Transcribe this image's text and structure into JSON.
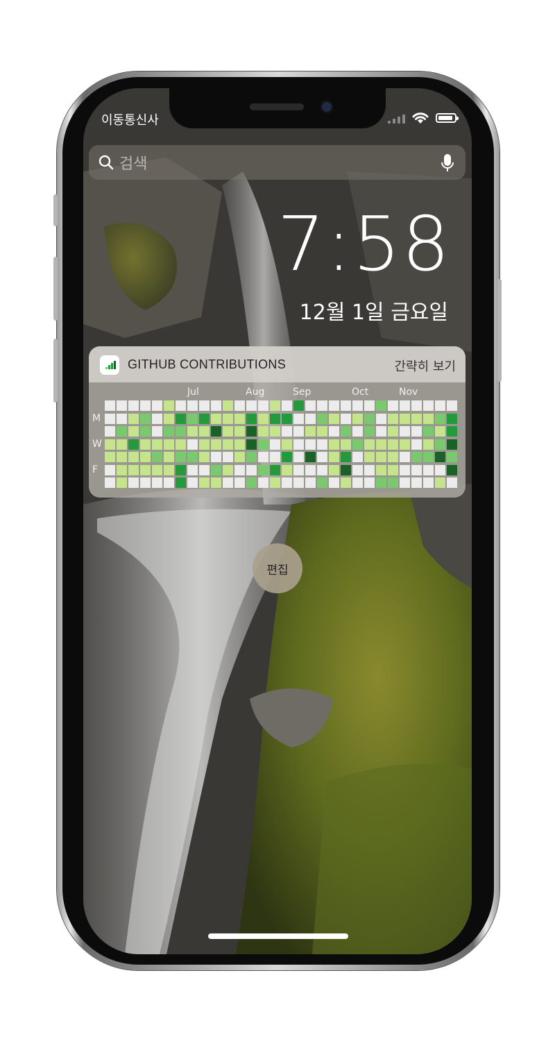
{
  "status_bar": {
    "carrier": "이동통신사"
  },
  "search": {
    "placeholder": "검색"
  },
  "clock": {
    "time": "7:58",
    "date": "12월 1일 금요일"
  },
  "widget": {
    "title": "GITHUB CONTRIBUTIONS",
    "toggle_label": "간략히 보기",
    "months": [
      "Jul",
      "Aug",
      "Sep",
      "Oct",
      "Nov"
    ],
    "day_labels": [
      "M",
      "W",
      "F"
    ],
    "colors": [
      "#ececec",
      "#c6e48b",
      "#7bc96f",
      "#239a3b",
      "#196127"
    ],
    "grid": [
      [
        0,
        0,
        0,
        0,
        0,
        1,
        0,
        0,
        0,
        0,
        1,
        0,
        0,
        0,
        1,
        0,
        3,
        0,
        0,
        0,
        0,
        0,
        0,
        2,
        0,
        0,
        0,
        0,
        0,
        0
      ],
      [
        0,
        0,
        1,
        2,
        0,
        1,
        3,
        2,
        3,
        1,
        1,
        1,
        3,
        1,
        3,
        3,
        0,
        0,
        2,
        1,
        0,
        1,
        2,
        0,
        1,
        1,
        1,
        1,
        2,
        3
      ],
      [
        0,
        2,
        1,
        2,
        0,
        2,
        2,
        1,
        1,
        4,
        1,
        1,
        4,
        1,
        1,
        0,
        0,
        1,
        1,
        0,
        2,
        0,
        2,
        0,
        1,
        0,
        0,
        2,
        1,
        3
      ],
      [
        1,
        1,
        3,
        1,
        1,
        1,
        1,
        0,
        1,
        1,
        1,
        1,
        4,
        2,
        0,
        1,
        0,
        0,
        0,
        1,
        1,
        2,
        1,
        1,
        1,
        1,
        0,
        1,
        2,
        4
      ],
      [
        1,
        1,
        1,
        1,
        2,
        1,
        2,
        2,
        1,
        0,
        0,
        1,
        2,
        0,
        0,
        3,
        0,
        4,
        0,
        1,
        3,
        0,
        1,
        1,
        1,
        0,
        2,
        2,
        4,
        2
      ],
      [
        0,
        1,
        1,
        1,
        1,
        1,
        3,
        0,
        0,
        2,
        1,
        0,
        0,
        2,
        3,
        1,
        0,
        0,
        0,
        1,
        4,
        0,
        0,
        1,
        1,
        0,
        0,
        0,
        0,
        4
      ],
      [
        0,
        1,
        0,
        0,
        0,
        0,
        3,
        0,
        1,
        1,
        0,
        0,
        2,
        0,
        1,
        0,
        0,
        0,
        2,
        0,
        1,
        0,
        0,
        2,
        2,
        0,
        0,
        0,
        1,
        0
      ]
    ]
  },
  "edit_button": {
    "label": "편집"
  }
}
